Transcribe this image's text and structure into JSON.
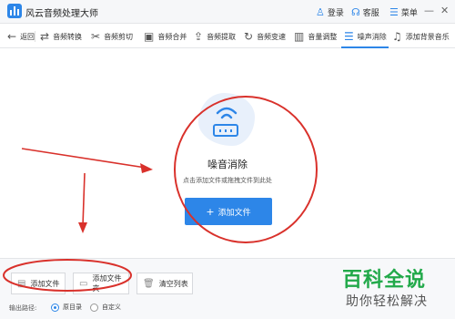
{
  "app": {
    "title": "风云音频处理大师",
    "login": "登录",
    "service": "客服",
    "menu": "菜单"
  },
  "toolbar": {
    "back": "返回",
    "items": [
      {
        "label": "音频转换",
        "icon": "convert-icon"
      },
      {
        "label": "音频剪切",
        "icon": "scissors-icon"
      },
      {
        "label": "音频合并",
        "icon": "merge-icon"
      },
      {
        "label": "音频提取",
        "icon": "extract-icon"
      },
      {
        "label": "音频变速",
        "icon": "speed-icon"
      },
      {
        "label": "音量调整",
        "icon": "volume-icon"
      },
      {
        "label": "噪声消除",
        "icon": "noise-icon",
        "active": true
      },
      {
        "label": "添加背景音乐",
        "icon": "music-icon"
      }
    ]
  },
  "main": {
    "title": "噪音消除",
    "subtitle": "点击添加文件或拖拽文件到此处",
    "add_file_button": "添加文件"
  },
  "bottom": {
    "add_file": "添加文件",
    "add_folder": "添加文件夹",
    "clear_list": "清空列表",
    "output_label": "输出路径:",
    "option_original": "原目录",
    "option_custom": "自定义",
    "selected_option": "原目录"
  },
  "watermark": {
    "main": "百科全说",
    "sub": "助你轻松解决"
  },
  "colors": {
    "accent": "#2d86e8",
    "annotation_red": "#d9312b",
    "watermark_green": "#22a94a"
  }
}
